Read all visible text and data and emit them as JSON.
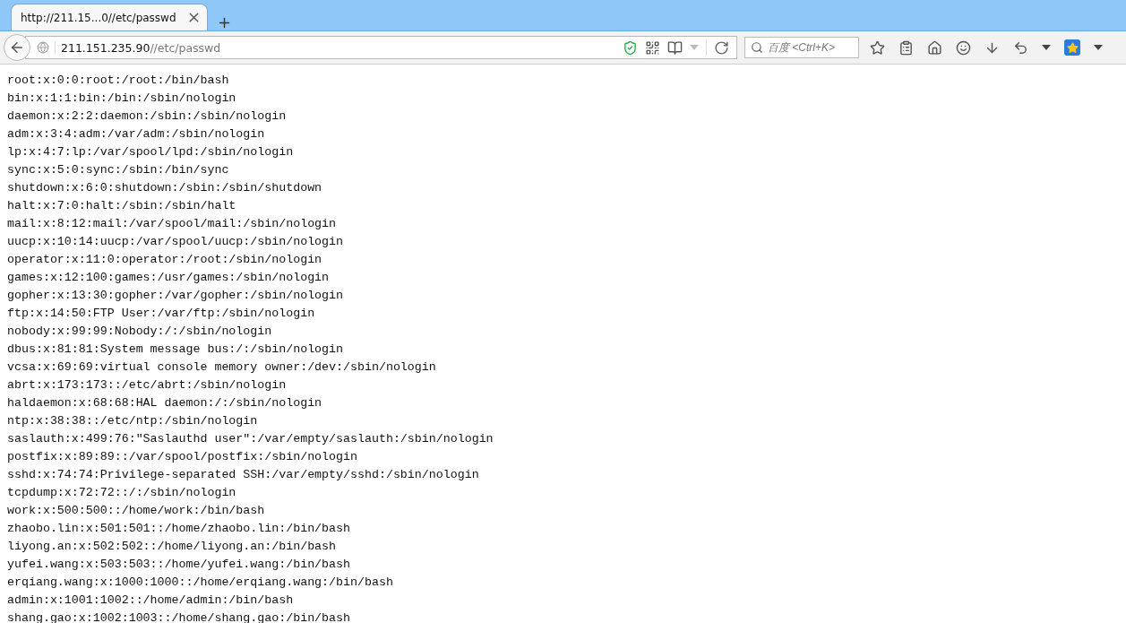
{
  "tab": {
    "title": "http://211.15...0//etc/passwd",
    "selected": true
  },
  "address_bar": {
    "host": "211.151.235.90",
    "path": "//etc/passwd"
  },
  "search": {
    "placeholder": "百度 <Ctrl+K>"
  },
  "lines": [
    "root:x:0:0:root:/root:/bin/bash",
    "bin:x:1:1:bin:/bin:/sbin/nologin",
    "daemon:x:2:2:daemon:/sbin:/sbin/nologin",
    "adm:x:3:4:adm:/var/adm:/sbin/nologin",
    "lp:x:4:7:lp:/var/spool/lpd:/sbin/nologin",
    "sync:x:5:0:sync:/sbin:/bin/sync",
    "shutdown:x:6:0:shutdown:/sbin:/sbin/shutdown",
    "halt:x:7:0:halt:/sbin:/sbin/halt",
    "mail:x:8:12:mail:/var/spool/mail:/sbin/nologin",
    "uucp:x:10:14:uucp:/var/spool/uucp:/sbin/nologin",
    "operator:x:11:0:operator:/root:/sbin/nologin",
    "games:x:12:100:games:/usr/games:/sbin/nologin",
    "gopher:x:13:30:gopher:/var/gopher:/sbin/nologin",
    "ftp:x:14:50:FTP User:/var/ftp:/sbin/nologin",
    "nobody:x:99:99:Nobody:/:/sbin/nologin",
    "dbus:x:81:81:System message bus:/:/sbin/nologin",
    "vcsa:x:69:69:virtual console memory owner:/dev:/sbin/nologin",
    "abrt:x:173:173::/etc/abrt:/sbin/nologin",
    "haldaemon:x:68:68:HAL daemon:/:/sbin/nologin",
    "ntp:x:38:38::/etc/ntp:/sbin/nologin",
    "saslauth:x:499:76:\"Saslauthd user\":/var/empty/saslauth:/sbin/nologin",
    "postfix:x:89:89::/var/spool/postfix:/sbin/nologin",
    "sshd:x:74:74:Privilege-separated SSH:/var/empty/sshd:/sbin/nologin",
    "tcpdump:x:72:72::/:/sbin/nologin",
    "work:x:500:500::/home/work:/bin/bash",
    "zhaobo.lin:x:501:501::/home/zhaobo.lin:/bin/bash",
    "liyong.an:x:502:502::/home/liyong.an:/bin/bash",
    "yufei.wang:x:503:503::/home/yufei.wang:/bin/bash",
    "erqiang.wang:x:1000:1000::/home/erqiang.wang:/bin/bash",
    "admin:x:1001:1002::/home/admin:/bin/bash",
    "shang.gao:x:1002:1003::/home/shang.gao:/bin/bash"
  ]
}
